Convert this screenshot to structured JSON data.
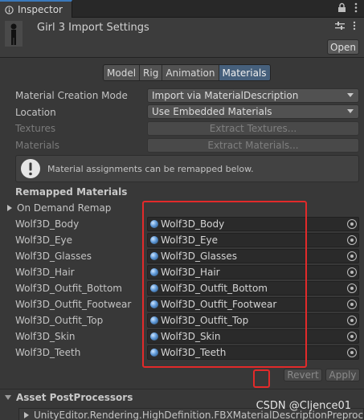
{
  "window": {
    "tab_label": "Inspector",
    "lock_icon": "lock-icon",
    "menu_icon": "kebab-menu-icon"
  },
  "header": {
    "title": "Girl 3 Import Settings",
    "open_label": "Open"
  },
  "tabs": [
    {
      "label": "Model",
      "active": false
    },
    {
      "label": "Rig",
      "active": false
    },
    {
      "label": "Animation",
      "active": false
    },
    {
      "label": "Materials",
      "active": true
    }
  ],
  "settings": {
    "creation_mode_label": "Material Creation Mode",
    "creation_mode_value": "Import via MaterialDescription",
    "location_label": "Location",
    "location_value": "Use Embedded Materials",
    "textures_label": "Textures",
    "textures_button": "Extract Textures...",
    "materials_label": "Materials",
    "materials_button": "Extract Materials..."
  },
  "help": {
    "text": "Material assignments can be remapped below."
  },
  "remapped": {
    "title": "Remapped Materials",
    "on_demand_label": "On Demand Remap",
    "items": [
      {
        "label": "Wolf3D_Body",
        "value": "Wolf3D_Body"
      },
      {
        "label": "Wolf3D_Eye",
        "value": "Wolf3D_Eye"
      },
      {
        "label": "Wolf3D_Glasses",
        "value": "Wolf3D_Glasses"
      },
      {
        "label": "Wolf3D_Hair",
        "value": "Wolf3D_Hair"
      },
      {
        "label": "Wolf3D_Outfit_Bottom",
        "value": "Wolf3D_Outfit_Bottom"
      },
      {
        "label": "Wolf3D_Outfit_Footwear",
        "value": "Wolf3D_Outfit_Footwear"
      },
      {
        "label": "Wolf3D_Outfit_Top",
        "value": "Wolf3D_Outfit_Top"
      },
      {
        "label": "Wolf3D_Skin",
        "value": "Wolf3D_Skin"
      },
      {
        "label": "Wolf3D_Teeth",
        "value": "Wolf3D_Teeth"
      }
    ]
  },
  "actions": {
    "revert_label": "Revert",
    "apply_label": "Apply"
  },
  "postprocessors": {
    "title": "Asset PostProcessors",
    "item": "UnityEditor.Rendering.HighDefinition.FBXMaterialDescriptionPreprocessor"
  },
  "watermark": "CSDN @Cljence01",
  "colors": {
    "background": "#383838",
    "active_tab": "#46607c",
    "highlight": "#e22a2a"
  }
}
